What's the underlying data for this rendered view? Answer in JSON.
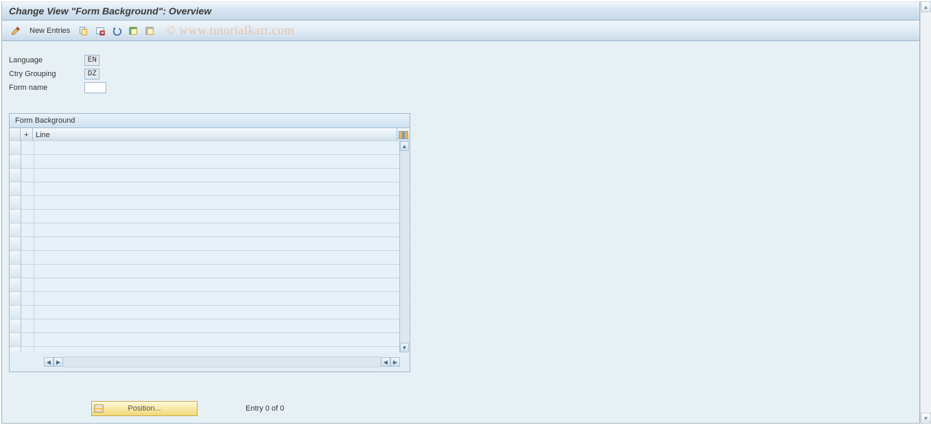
{
  "title": "Change View \"Form Background\": Overview",
  "toolbar": {
    "new_entries_label": "New Entries"
  },
  "fields": {
    "language_label": "Language",
    "language_value": "EN",
    "ctry_label": "Ctry Grouping",
    "ctry_value": "DZ",
    "form_label": "Form name",
    "form_value": ""
  },
  "table": {
    "title": "Form Background",
    "col_plus": "+",
    "col_line": "Line",
    "rows": [
      "",
      "",
      "",
      "",
      "",
      "",
      "",
      "",
      "",
      "",
      "",
      "",
      "",
      "",
      "",
      ""
    ]
  },
  "footer": {
    "position_label": "Position...",
    "entry_text": "Entry 0 of 0"
  },
  "watermark": "© www.tutorialkart.com"
}
